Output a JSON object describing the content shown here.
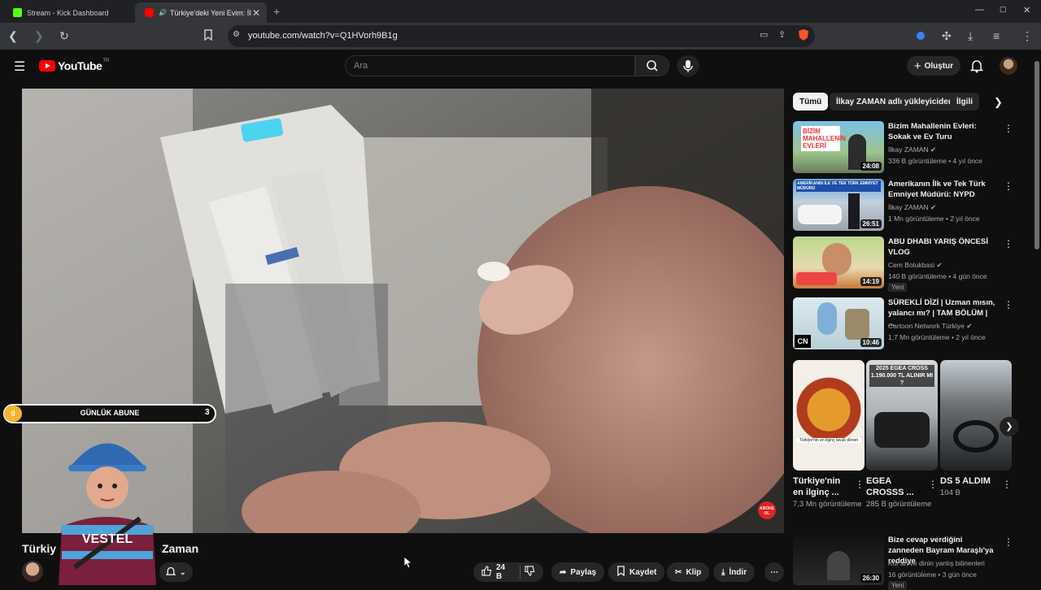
{
  "browser": {
    "tabs": [
      {
        "label": "Stream - Kick Dashboard",
        "favicon_color": "#53fc18"
      },
      {
        "label": "Türkiye'deki Yeni Evim: İlka",
        "favicon_color": "#ff0000"
      }
    ],
    "new_tab_symbol": "+",
    "url": "youtube.com/watch?v=Q1HVorh9B1g",
    "window_controls": [
      "—",
      "▢",
      "✕"
    ]
  },
  "youtube": {
    "logo_text": "YouTube",
    "logo_region": "TR",
    "search_placeholder": "Ara",
    "create_label": "Oluştur"
  },
  "overlay": {
    "counter_start": "0",
    "label": "GÜNLÜK ABUNE",
    "counter_end": "3",
    "progress": 0.0,
    "abone_badge": "ABONE OL"
  },
  "filter_chips": [
    "Tümü",
    "İlkay ZAMAN adlı yükleyiciden",
    "İlgili"
  ],
  "recommendations": [
    {
      "title": "Bizim Mahallenin Evleri: Sokak ve Ev Turu",
      "channel": "İlkay ZAMAN",
      "verified": true,
      "meta": "336 B görüntüleme • 4 yıl önce",
      "duration": "24:08",
      "thumb_text": "BİZİM MAHALLENİN EVLERİ"
    },
    {
      "title": "Amerikanın İlk ve Tek Türk Emniyet Müdürü: NYPD",
      "channel": "İlkay ZAMAN",
      "verified": true,
      "meta": "1 Mn görüntüleme • 2 yıl önce",
      "duration": "26:51",
      "thumb_text": "AMERİKANIN İLK VE TEK TÜRK EMNİYET MÜDÜRÜ"
    },
    {
      "title": "ABU DHABI YARIŞ ÖNCESİ VLOG",
      "channel": "Cem Bolukbasi",
      "verified": true,
      "meta": "140 B görüntüleme • 4 gün önce",
      "duration": "14:19",
      "badge": "Yeni"
    },
    {
      "title": "SÜREKLİ DİZİ | Uzman mısın, yalancı mı? | TAM BÖLÜM | ...",
      "channel": "Cartoon Network Türkiye",
      "verified": true,
      "meta": "1,7 Mn görüntüleme • 2 yıl önce",
      "duration": "10:46",
      "thumb_text": "CN"
    }
  ],
  "shorts": [
    {
      "title": "Türkiye'nin en ilginç ...",
      "views": "7,3 Mn görüntüleme",
      "caption": "Türkiye'nin en ilginç tavuk döneri"
    },
    {
      "title": "EGEA CROSSS ...",
      "views": "285 B görüntüleme",
      "caption": "2025 EGEA CROSS 1.190.000 TL ALINIR MI ?"
    },
    {
      "title": "DS 5 ALDIM",
      "views": "104 B"
    }
  ],
  "bottom_recommendation": {
    "title": "Bize cevap verdiğini zanneden Bayram Maraşlı'ya reddiye",
    "channel": "Kur'an ve dinin yanlış bilinenleri",
    "meta": "16 görüntüleme • 3 gün önce",
    "duration": "26:30",
    "badge": "Yeni"
  },
  "video": {
    "title_left": "Türkiy",
    "title_right": "Zaman",
    "like_count": "24 B",
    "share_label": "Paylaş",
    "save_label": "Kaydet",
    "clip_label": "Klip",
    "download_label": "İndir"
  },
  "colors": {
    "yt_red": "#ff0000",
    "bg": "#0f0f0f",
    "chip_bg": "#272727",
    "overlay_coin": "#f2b632"
  }
}
